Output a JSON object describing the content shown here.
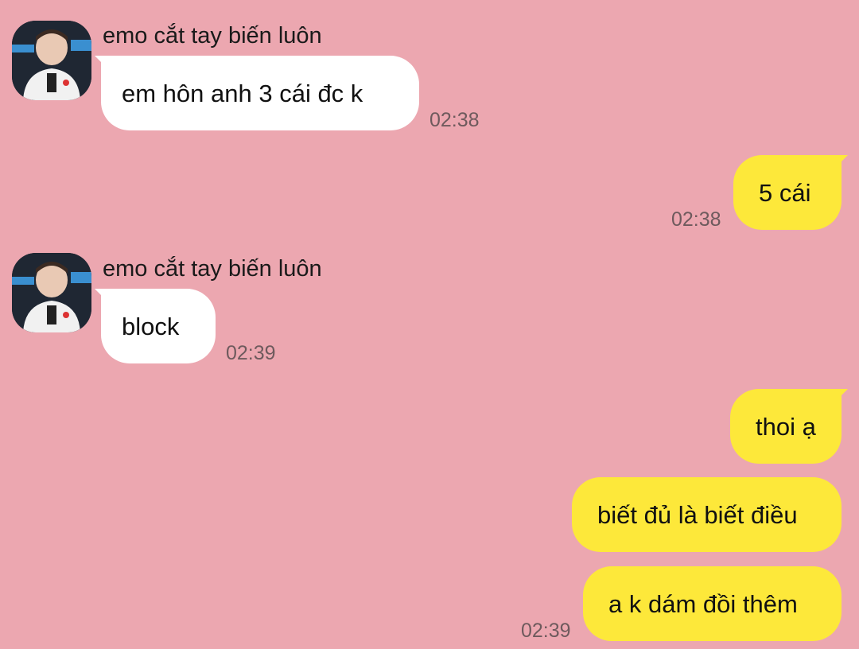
{
  "messages": [
    {
      "sender": "emo cắt tay biến luôn",
      "text": "em hôn anh  3 cái đc k",
      "time": "02:38",
      "avatar_icon": "user-avatar-icon"
    },
    {
      "text": "5 cái",
      "time": "02:38"
    },
    {
      "sender": "emo cắt tay biến luôn",
      "text": "block",
      "time": "02:39",
      "avatar_icon": "user-avatar-icon"
    },
    {
      "text": "thoi ạ"
    },
    {
      "text": "biết đủ là biết điều"
    },
    {
      "text": "a k dám đồi thêm",
      "time": "02:39"
    }
  ],
  "colors": {
    "background": "#eca7b0",
    "incoming_bubble": "#ffffff",
    "outgoing_bubble": "#fde83a"
  }
}
